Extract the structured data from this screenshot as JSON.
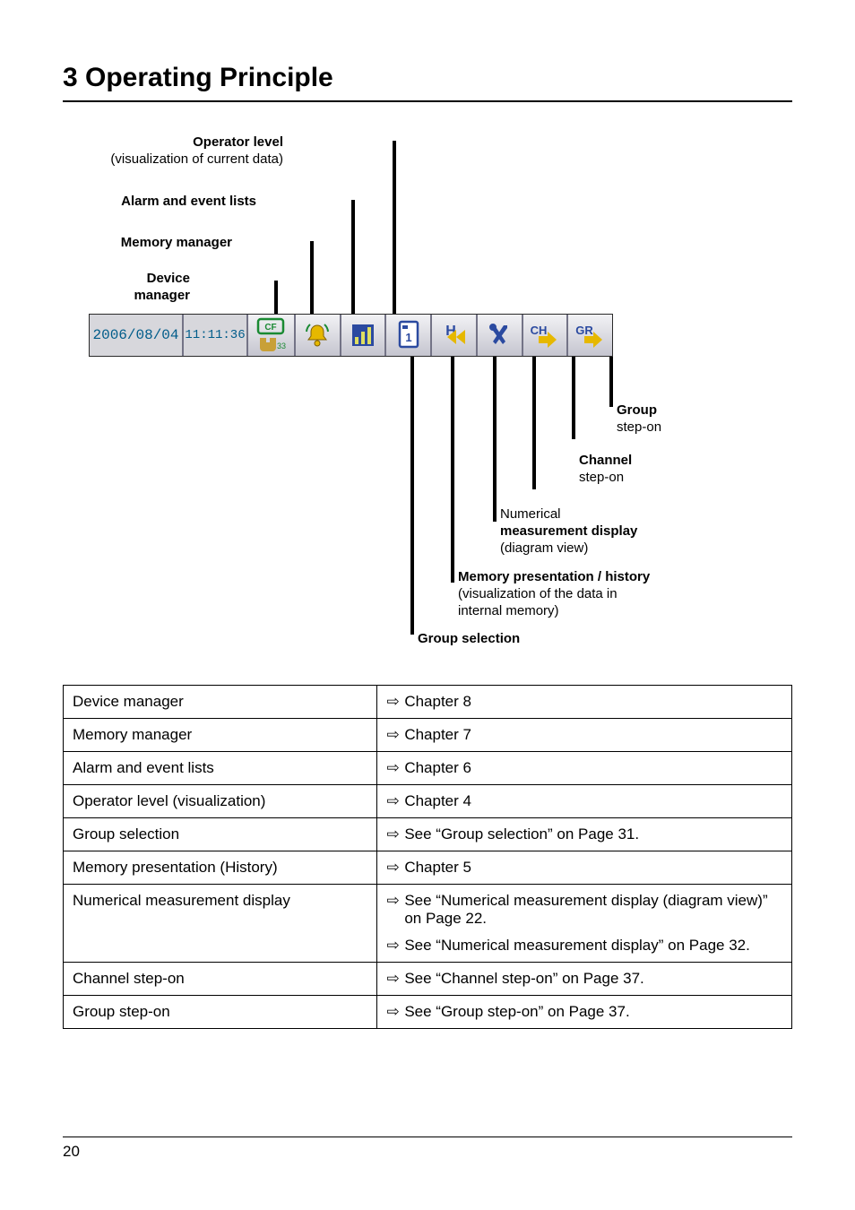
{
  "title": "3 Operating Principle",
  "diagram": {
    "operator_level_bold": "Operator level",
    "operator_level_plain": "(visualization of current data)",
    "alarm_bold": "Alarm and event lists",
    "memory_mgr_bold": "Memory manager",
    "device_bold1": "Device",
    "device_bold2": "manager",
    "toolbar": {
      "date": "2006/08/04",
      "time": "11:11:36",
      "cf_label": "CF",
      "cf_pct": "33%",
      "h_label": "H",
      "ch_label": "CH",
      "gr_label": "GR"
    },
    "group_bold": "Group",
    "group_plain": "step-on",
    "channel_bold": "Channel",
    "channel_plain": "step-on",
    "numerical_plain1": "Numerical",
    "numerical_bold": "measurement display",
    "numerical_plain2": "(diagram view)",
    "mempres_bold": "Memory presentation / history",
    "mempres_plain1": "(visualization of the data in",
    "mempres_plain2": "internal memory)",
    "gselect_bold": "Group selection"
  },
  "table": {
    "rows": [
      {
        "left": "Device manager",
        "right": [
          {
            "t": "Chapter 8"
          }
        ]
      },
      {
        "left": "Memory manager",
        "right": [
          {
            "t": "Chapter 7"
          }
        ]
      },
      {
        "left": "Alarm and event lists",
        "right": [
          {
            "t": "Chapter 6"
          }
        ]
      },
      {
        "left": "Operator level (visualization)",
        "right": [
          {
            "t": "Chapter 4"
          }
        ]
      },
      {
        "left": "Group selection",
        "right": [
          {
            "t": "See “Group selection” on Page  31."
          }
        ]
      },
      {
        "left": "Memory presentation (History)",
        "right": [
          {
            "t": "Chapter 5"
          }
        ]
      },
      {
        "left": "Numerical measurement display",
        "right": [
          {
            "t": "See “Numerical measurement display (diagram view)” on Page  22."
          },
          {
            "t": "See “Numerical measurement display” on Page  32."
          }
        ]
      },
      {
        "left": "Channel step-on",
        "right": [
          {
            "t": "See “Channel step-on” on Page  37."
          }
        ]
      },
      {
        "left": "Group step-on",
        "right": [
          {
            "t": "See “Group step-on” on Page  37."
          }
        ]
      }
    ]
  },
  "page_number": "20",
  "arrow_glyph": "⇨"
}
